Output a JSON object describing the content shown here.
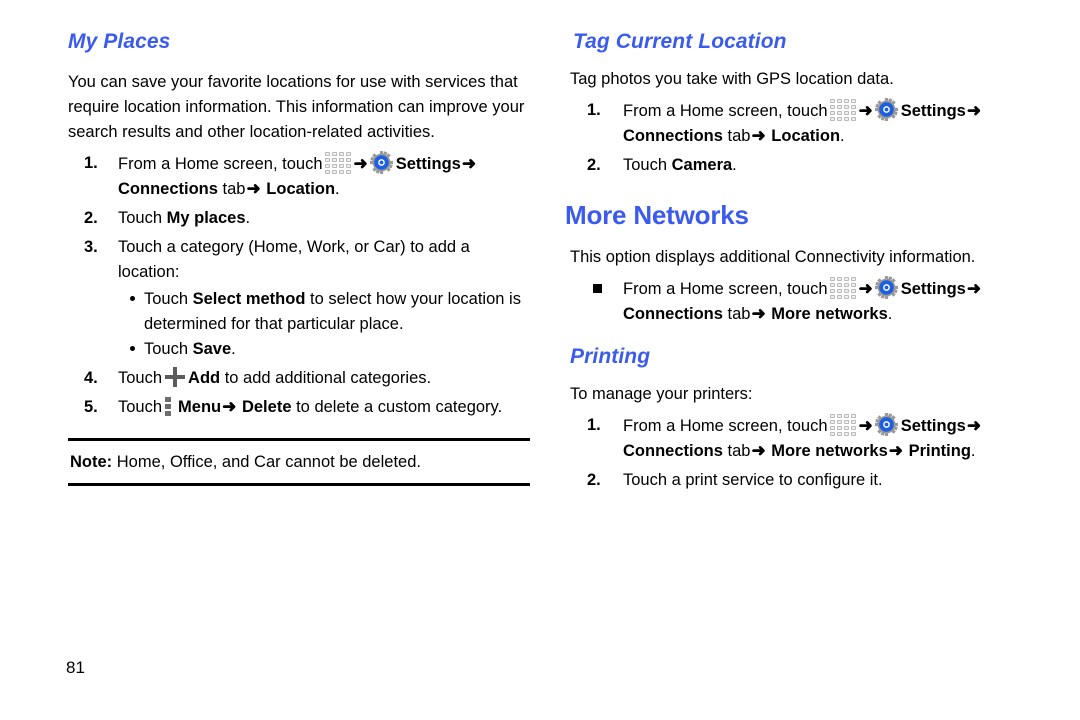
{
  "page": {
    "number": "81",
    "icons": {
      "apps_grid": "apps-grid-icon",
      "settings_gear": "settings-gear-icon",
      "add_plus": "plus-icon",
      "menu_kebab": "kebab-menu-icon",
      "arrow": "➜"
    },
    "colors": {
      "heading_blue": "#3a5bed",
      "body_text": "#000000",
      "icon_gray": "#b9b9b9",
      "gear_blue": "#1d5fe0"
    }
  },
  "left_column": {
    "heading": "My Places",
    "intro": "You can save your favorite locations for use with services that require location information. This information can improve your search results and other location-related activities.",
    "steps": [
      {
        "num": "1.",
        "pre": "From a Home screen, touch",
        "settings_label": "Settings",
        "connections_label": "Connections",
        "tab_word": "tab",
        "location_label": "Location",
        "period": "."
      },
      {
        "num": "2.",
        "pre": "Touch",
        "bold": "My places",
        "post": "."
      },
      {
        "num": "3.",
        "text": "Touch a category (Home, Work, or Car) to add a location:",
        "sub_bullets": [
          {
            "pre": "Touch",
            "bold": "Select method",
            "post": "to select how your location is determined for that particular place."
          },
          {
            "pre": "Touch",
            "bold": "Save",
            "post": "."
          }
        ]
      },
      {
        "num": "4.",
        "pre": "Touch",
        "bold": "Add",
        "post": "to add additional categories."
      },
      {
        "num": "5.",
        "pre": "Touch",
        "bold": "Menu",
        "bold2": "Delete",
        "post": "to delete a custom category."
      }
    ],
    "note": {
      "label": "Note:",
      "text": "Home, Office, and Car cannot be deleted."
    }
  },
  "right_column": {
    "tag_current_location": {
      "heading": "Tag Current Location",
      "intro": "Tag photos you take with GPS location data.",
      "steps": [
        {
          "num": "1.",
          "pre": "From a Home screen, touch",
          "settings_label": "Settings",
          "connections_label": "Connections",
          "tab_word": "tab",
          "location_label": "Location",
          "period": "."
        },
        {
          "num": "2.",
          "pre": "Touch",
          "bold": "Camera",
          "post": "."
        }
      ]
    },
    "more_networks": {
      "heading": "More Networks",
      "intro": "This option displays additional Connectivity information.",
      "bullet": {
        "pre": "From a Home screen, touch",
        "settings_label": "Settings",
        "connections_label": "Connections",
        "tab_word": "tab",
        "target_label": "More networks",
        "period": "."
      }
    },
    "printing": {
      "heading": "Printing",
      "intro": "To manage your printers:",
      "steps": [
        {
          "num": "1.",
          "pre": "From a Home screen, touch",
          "settings_label": "Settings",
          "connections_label": "Connections",
          "tab_word": "tab",
          "target_label": "More networks",
          "target2_label": "Printing",
          "period": "."
        },
        {
          "num": "2.",
          "text": "Touch a print service to configure it."
        }
      ]
    }
  }
}
